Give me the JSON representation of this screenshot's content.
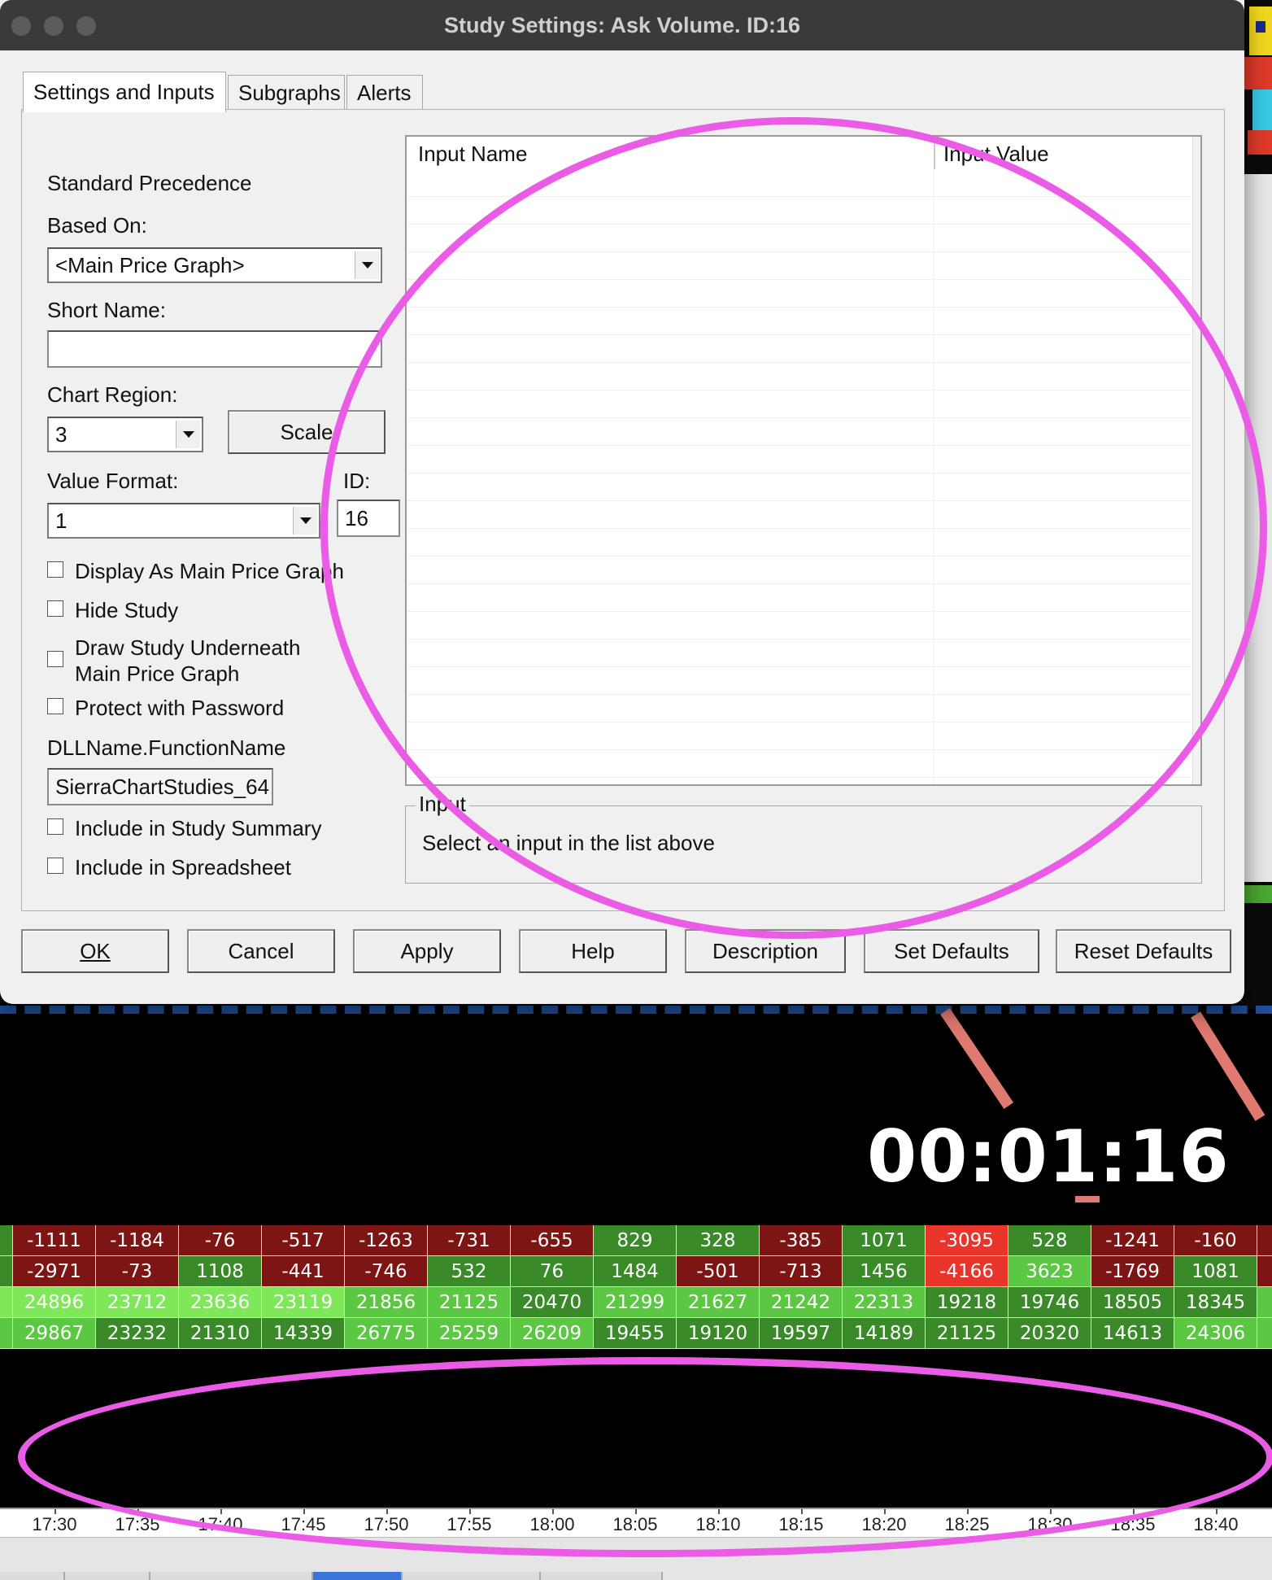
{
  "dialog": {
    "title": "Study Settings: Ask Volume. ID:16",
    "tabs": [
      {
        "label": "Settings and Inputs",
        "active": true
      },
      {
        "label": "Subgraphs",
        "active": false
      },
      {
        "label": "Alerts",
        "active": false
      }
    ],
    "standard_precedence": "Standard Precedence",
    "based_on_label": "Based On:",
    "based_on_value": "<Main Price Graph>",
    "short_name_label": "Short Name:",
    "short_name_value": "",
    "chart_region_label": "Chart Region:",
    "chart_region_value": "3",
    "scale_button": "Scale",
    "value_format_label": "Value Format:",
    "value_format_value": "1",
    "id_label": "ID:",
    "id_value": "16",
    "checkboxes": {
      "display_as_main": {
        "label": "Display As Main Price Graph",
        "checked": false
      },
      "hide_study": {
        "label": "Hide Study",
        "checked": false
      },
      "draw_underneath_1": "Draw Study Underneath",
      "draw_underneath_2": "Main Price Graph",
      "protect_password": {
        "label": "Protect with Password",
        "checked": false
      },
      "include_summary": {
        "label": "Include in Study Summary",
        "checked": false
      },
      "include_spreadsheet": {
        "label": "Include in Spreadsheet",
        "checked": false
      }
    },
    "dll_label": "DLLName.FunctionName",
    "dll_value": "SierraChartStudies_64",
    "list": {
      "col_input_name": "Input Name",
      "col_input_value": "Input Value"
    },
    "input_group": {
      "legend": "Input",
      "description": "Select an input in the list above"
    },
    "buttons": {
      "ok": "OK",
      "cancel": "Cancel",
      "apply": "Apply",
      "help": "Help",
      "description": "Description",
      "set_defaults": "Set Defaults",
      "reset_defaults": "Reset Defaults"
    }
  },
  "chart": {
    "timer": "00:01:16",
    "grid": [
      [
        "-1111",
        "-1184",
        "-76",
        "-517",
        "-1263",
        "-731",
        "-655",
        "829",
        "328",
        "-385",
        "1071",
        "-3095",
        "528",
        "-1241",
        "-160"
      ],
      [
        "-2971",
        "-73",
        "1108",
        "-441",
        "-746",
        "532",
        "76",
        "1484",
        "-501",
        "-713",
        "1456",
        "-4166",
        "3623",
        "-1769",
        "1081"
      ],
      [
        "24896",
        "23712",
        "23636",
        "23119",
        "21856",
        "21125",
        "20470",
        "21299",
        "21627",
        "21242",
        "22313",
        "19218",
        "19746",
        "18505",
        "18345"
      ],
      [
        "29867",
        "23232",
        "21310",
        "14339",
        "26775",
        "25259",
        "26209",
        "19455",
        "19120",
        "19597",
        "14189",
        "21125",
        "20320",
        "14613",
        "24306"
      ]
    ],
    "time_labels": [
      "17:30",
      "17:35",
      "17:40",
      "17:45",
      "17:50",
      "17:55",
      "18:00",
      "18:05",
      "18:10",
      "18:15",
      "18:20",
      "18:25",
      "18:30",
      "18:35",
      "18:40"
    ],
    "colors": {
      "dark_red": "#7d1515",
      "bright_red": "#e8342a",
      "dark_green": "#3a8a2a",
      "mid_green": "#5cc743",
      "light_green": "#7ee85a",
      "annotation": "#ea5ce6"
    }
  }
}
